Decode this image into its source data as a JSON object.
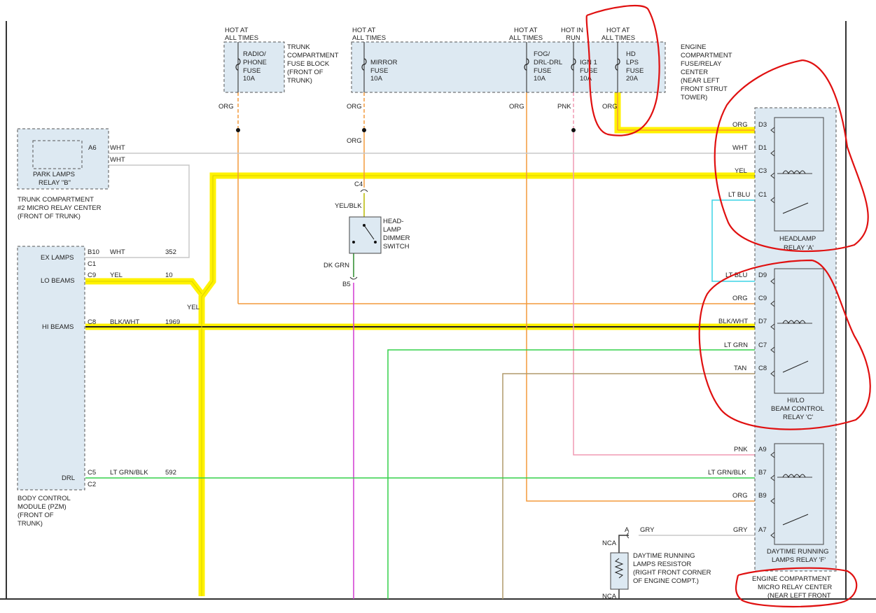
{
  "labels": {
    "hot_at": "HOT AT",
    "all_times": "ALL TIMES",
    "hot_in": "HOT IN",
    "run": "RUN",
    "org": "ORG",
    "pnk": "PNK",
    "wht": "WHT",
    "yel": "YEL",
    "yel_blk": "YEL/BLK",
    "dk_grn": "DK GRN",
    "blk_wht": "BLK/WHT",
    "lt_grn": "LT GRN",
    "lt_blu": "LT BLU",
    "tan": "TAN",
    "lt_grn_blk": "LT GRN/BLK",
    "gry": "GRY",
    "nca": "NCA"
  },
  "fuses": {
    "radio": [
      "RADIO/",
      "PHONE",
      "FUSE",
      "10A"
    ],
    "mirror": [
      "MIRROR",
      "FUSE",
      "10A"
    ],
    "fog": [
      "FOG/",
      "DRL-DRL",
      "FUSE",
      "10A"
    ],
    "ign": [
      "IGN 1",
      "FUSE",
      "10A"
    ],
    "hd": [
      "HD",
      "LPS",
      "FUSE",
      "20A"
    ]
  },
  "trunk_fuse_block": [
    "TRUNK",
    "COMPARTMENT",
    "FUSE BLOCK",
    "(FRONT OF",
    "TRUNK)"
  ],
  "engine_fuse_center": [
    "ENGINE",
    "COMPARTMENT",
    "FUSE/RELAY",
    "CENTER",
    "(NEAR LEFT",
    "FRONT STRUT",
    "TOWER)"
  ],
  "park_relay": {
    "name": [
      "PARK LAMPS",
      "RELAY \"B\""
    ],
    "pin": "A6",
    "location": [
      "TRUNK COMPARTMENT",
      "#2 MICRO RELAY CENTER",
      "(FRONT OF TRUNK)"
    ]
  },
  "bcm": {
    "ex_lamps": "EX LAMPS",
    "lo_beams": "LO BEAMS",
    "hi_beams": "HI BEAMS",
    "drl": "DRL",
    "pins": [
      "B10",
      "C1",
      "C9",
      "C8",
      "C5",
      "C2"
    ],
    "name": [
      "BODY CONTROL",
      "MODULE (PZM)",
      "(FRONT OF",
      "TRUNK)"
    ],
    "circuits": [
      "352",
      "10",
      "1969",
      "592"
    ]
  },
  "dimmer": {
    "name": [
      "HEAD-",
      "LAMP",
      "DIMMER",
      "SWITCH"
    ],
    "pin_top": "C4",
    "pin_bottom": "B5"
  },
  "headlamp_relay": {
    "pins": [
      "D3",
      "D1",
      "C3",
      "C1"
    ],
    "name": [
      "HEADLAMP",
      "RELAY 'A'"
    ]
  },
  "hilo_relay": {
    "pins": [
      "D9",
      "C9",
      "D7",
      "C7",
      "C8"
    ],
    "name": [
      "HI/LO",
      "BEAM CONTROL",
      "RELAY 'C'"
    ]
  },
  "drl_relay": {
    "pins": [
      "A9",
      "B7",
      "B9",
      "A7"
    ],
    "name": [
      "DAYTIME RUNNING",
      "LAMPS RELAY 'F'"
    ]
  },
  "engine_micro_center": [
    "ENGINE COMPARTMENT",
    "MICRO RELAY CENTER",
    "(NEAR LEFT FRONT"
  ],
  "resistor": {
    "pin": "A",
    "name": [
      "DAYTIME RUNNING",
      "LAMPS RESISTOR",
      "(RIGHT FRONT CORNER",
      "OF ENGINE COMPT.)"
    ]
  },
  "colors": {
    "highlight": "#fff200",
    "org_wire": "#f39a3c",
    "pnk_wire": "#f09ab4",
    "wht_wire": "#c8c8c8",
    "grn_wire": "#33d14a",
    "blu_wire": "#3cd3e6",
    "tan_wire": "#b09a6c",
    "mag_wire": "#d23ad2",
    "box_fill": "#dde9f2",
    "annotation": "#e01010"
  }
}
